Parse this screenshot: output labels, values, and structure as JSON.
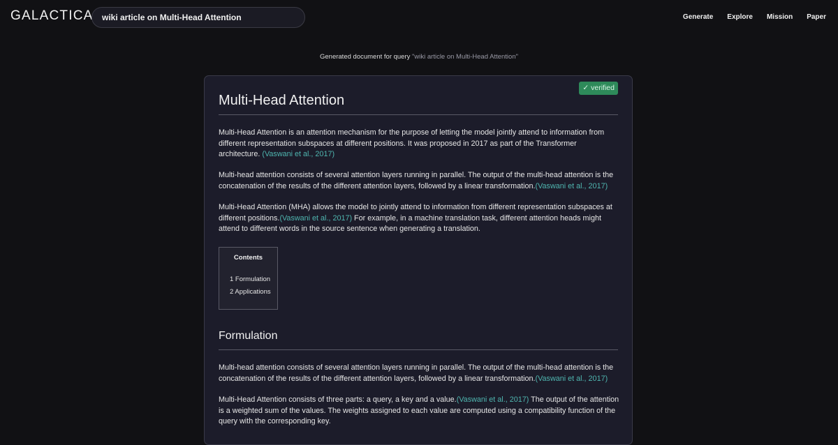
{
  "header": {
    "logo": "GALACTICA",
    "search_value": "wiki article on Multi-Head Attention",
    "nav": [
      "Generate",
      "Explore",
      "Mission",
      "Paper"
    ]
  },
  "query_line": {
    "prefix": "Generated document for query ",
    "query": "\"wiki article on Multi-Head Attention\""
  },
  "document": {
    "badge": "✓ verified",
    "title": "Multi-Head Attention",
    "paragraphs": [
      {
        "before": "Multi-Head Attention is an attention mechanism for the purpose of letting the model jointly attend to information from different representation subspaces at different positions. It was proposed in 2017 as part of the Transformer architecture. ",
        "cite": "(Vaswani et al., 2017)",
        "after": ""
      },
      {
        "before": "Multi-head attention consists of several attention layers running in parallel. The output of the multi-head attention is the concatenation of the results of the different attention layers, followed by a linear transformation.",
        "cite": "(Vaswani et al., 2017)",
        "after": ""
      },
      {
        "before": "Multi-Head Attention (MHA) allows the model to jointly attend to information from different representation subspaces at different positions.",
        "cite": "(Vaswani et al., 2017)",
        "after": " For example, in a machine translation task, different attention heads might attend to different words in the source sentence when generating a translation."
      }
    ],
    "toc": {
      "title": "Contents",
      "items": [
        "1 Formulation",
        "2 Applications"
      ]
    },
    "section_title": "Formulation",
    "section_paragraphs": [
      {
        "before": "Multi-head attention consists of several attention layers running in parallel. The output of the multi-head attention is the concatenation of the results of the different attention layers, followed by a linear transformation.",
        "cite": "(Vaswani et al., 2017)",
        "after": ""
      },
      {
        "before": "Multi-Head Attention consists of three parts: a query, a key and a value.",
        "cite": "(Vaswani et al., 2017)",
        "after": " The output of the attention is a weighted sum of the values. The weights assigned to each value are computed using a compatibility function of the query with the corresponding key."
      }
    ]
  },
  "colors": {
    "background": "#111114",
    "card": "#1c1c2a",
    "citation": "#4fb6b0",
    "badge": "#2e8a5a"
  }
}
